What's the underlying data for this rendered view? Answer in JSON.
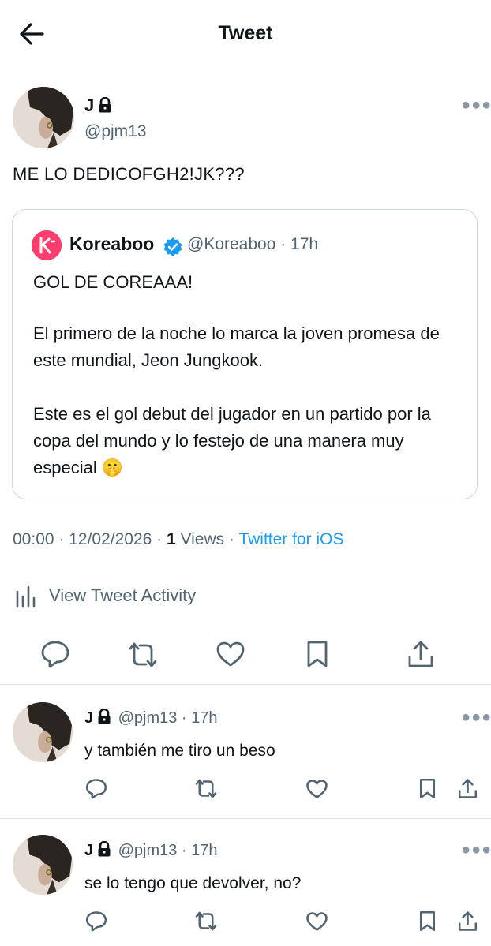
{
  "header": {
    "title": "Tweet"
  },
  "tweet": {
    "name": "J",
    "handle": "@pjm13",
    "text": "ME LO DEDICOFGH2!JK???",
    "quote": {
      "name": "Koreaboo",
      "handle": "@Koreaboo · 17h",
      "p1": "GOL DE COREAAA!",
      "p2": "El primero de la noche lo marca la joven promesa de este mundial, Jeon Jungkook.",
      "p3": "Este es el gol debut del jugador en un partido por la copa del mundo y lo festejo de una manera muy especial 🤫"
    },
    "meta": {
      "time_date": "00:00 · 12/02/2026 · ",
      "views_count": "1",
      "views_label": " Views · ",
      "client": "Twitter for iOS"
    },
    "activity_label": "View Tweet Activity"
  },
  "replies": [
    {
      "name": "J",
      "handle_time": "@pjm13 · 17h",
      "text": "y también me tiro un beso"
    },
    {
      "name": "J",
      "handle_time": "@pjm13 · 17h",
      "text": "se lo tengo que devolver, no?"
    }
  ],
  "icons": {
    "back": "arrow-left-icon",
    "lock": "lock-icon",
    "more": "more-icon",
    "verified": "verified-badge-icon",
    "reply": "reply-icon",
    "retweet": "retweet-icon",
    "like": "heart-icon",
    "bookmark": "bookmark-icon",
    "share": "share-icon",
    "activity": "bar-chart-icon"
  },
  "colors": {
    "link": "#1d9bf0",
    "muted": "#536471",
    "koreaboo": "#ff3d6e",
    "verified": "#1d9bf0"
  }
}
